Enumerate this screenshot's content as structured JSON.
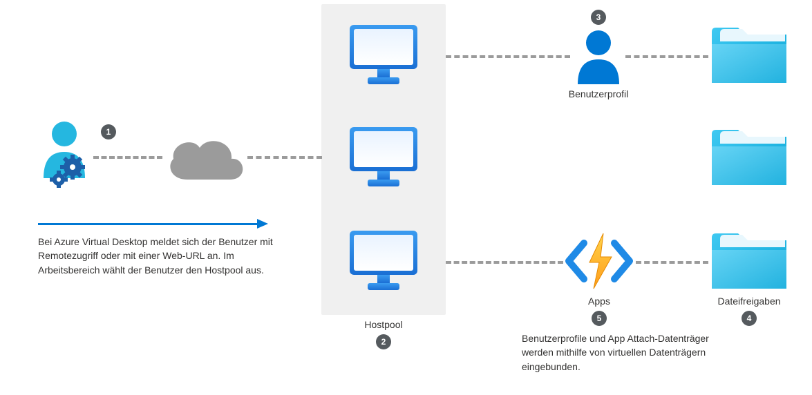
{
  "diagram": {
    "nodes": {
      "user_admin": {
        "badge": "1"
      },
      "hostpool": {
        "badge": "2",
        "label": "Hostpool"
      },
      "user_profile": {
        "badge": "3",
        "label": "Benutzerprofil"
      },
      "fileshares": {
        "badge": "4",
        "label": "Dateifreigaben"
      },
      "apps": {
        "badge": "5",
        "label": "Apps"
      }
    },
    "descriptions": {
      "left": "Bei Azure Virtual Desktop meldet sich der Benutzer mit Remotezugriff oder mit einer Web-URL an. Im Arbeitsbereich wählt der Benutzer den Hostpool aus.",
      "right": "Benutzerprofile und App Attach-Datenträger werden mithilfe von virtuellen Datenträgern eingebunden."
    }
  }
}
